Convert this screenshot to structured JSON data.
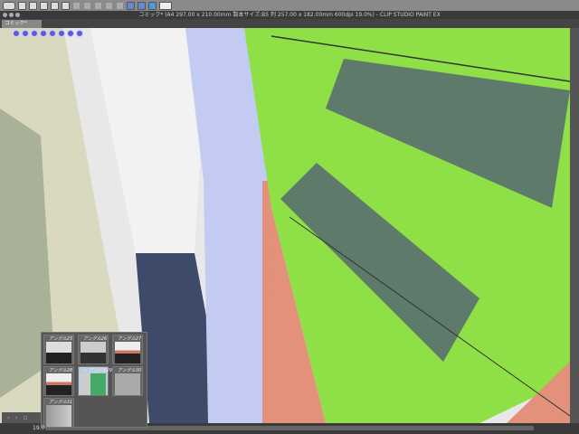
{
  "toolbar": {
    "icons": [
      "clip-studio-logo-icon",
      "new-icon",
      "open-icon",
      "save-icon",
      "undo-icon",
      "redo-icon",
      "select-icon",
      "transform-icon",
      "fill-icon",
      "crop-icon",
      "clear-icon",
      "ruler-icon",
      "snap-icon",
      "color-icon",
      "help-icon"
    ]
  },
  "titlebar": {
    "title": "コミック* (A4 297.00 x 210.00mm 製本サイズ:B5 判 257.00 x 182.00mm 600dpi 19.0%) - CLIP STUDIO PAINT EX"
  },
  "tab": {
    "label": "コミック*"
  },
  "angle_panel": {
    "items": [
      {
        "label": "アングル25",
        "selected": false
      },
      {
        "label": "アングル26",
        "selected": false
      },
      {
        "label": "アングル27",
        "selected": false
      },
      {
        "label": "アングル28",
        "selected": false
      },
      {
        "label": "✓ アングル29",
        "selected": true
      },
      {
        "label": "アングル30",
        "selected": false
      },
      {
        "label": "アングル31",
        "selected": false
      }
    ]
  },
  "status": {
    "zoom": "19.0"
  },
  "colors": {
    "green": "#8fe046",
    "salmon": "#e3917a",
    "blue_wall": "#c3cbf2",
    "road": "#3e4a6a"
  }
}
